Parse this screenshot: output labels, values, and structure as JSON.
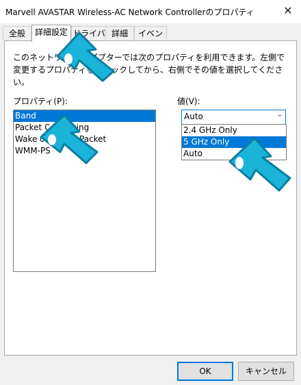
{
  "window": {
    "title": "Marvell AVASTAR Wireless-AC Network Controllerのプロパティ",
    "close_glyph": "✕"
  },
  "tabs": [
    {
      "label": "全般"
    },
    {
      "label": "詳細設定"
    },
    {
      "label": "ドライバー"
    },
    {
      "label": "詳細"
    },
    {
      "label": "イベント"
    }
  ],
  "panel": {
    "description": "このネットワーク アダプターでは次のプロパティを利用できます。左側で変更するプロパティをクリックしてから、右側でその値を選択してください。",
    "property_label": "プロパティ(P):",
    "value_label": "値(V):",
    "properties": [
      "Band",
      "Packet Coalescing",
      "Wake on Magic Packet",
      "WMM-PS"
    ],
    "selected_property": "Band",
    "value_combo": {
      "current": "Auto",
      "arrow": "⌄"
    },
    "value_options": [
      "2.4 GHz Only",
      "5 GHz Only",
      "Auto"
    ],
    "highlighted_option": "5 GHz Only"
  },
  "buttons": {
    "ok": "OK",
    "cancel": "キャンセル"
  },
  "colors": {
    "accent": "#0078d7",
    "cursor": "#1bb4d8"
  }
}
